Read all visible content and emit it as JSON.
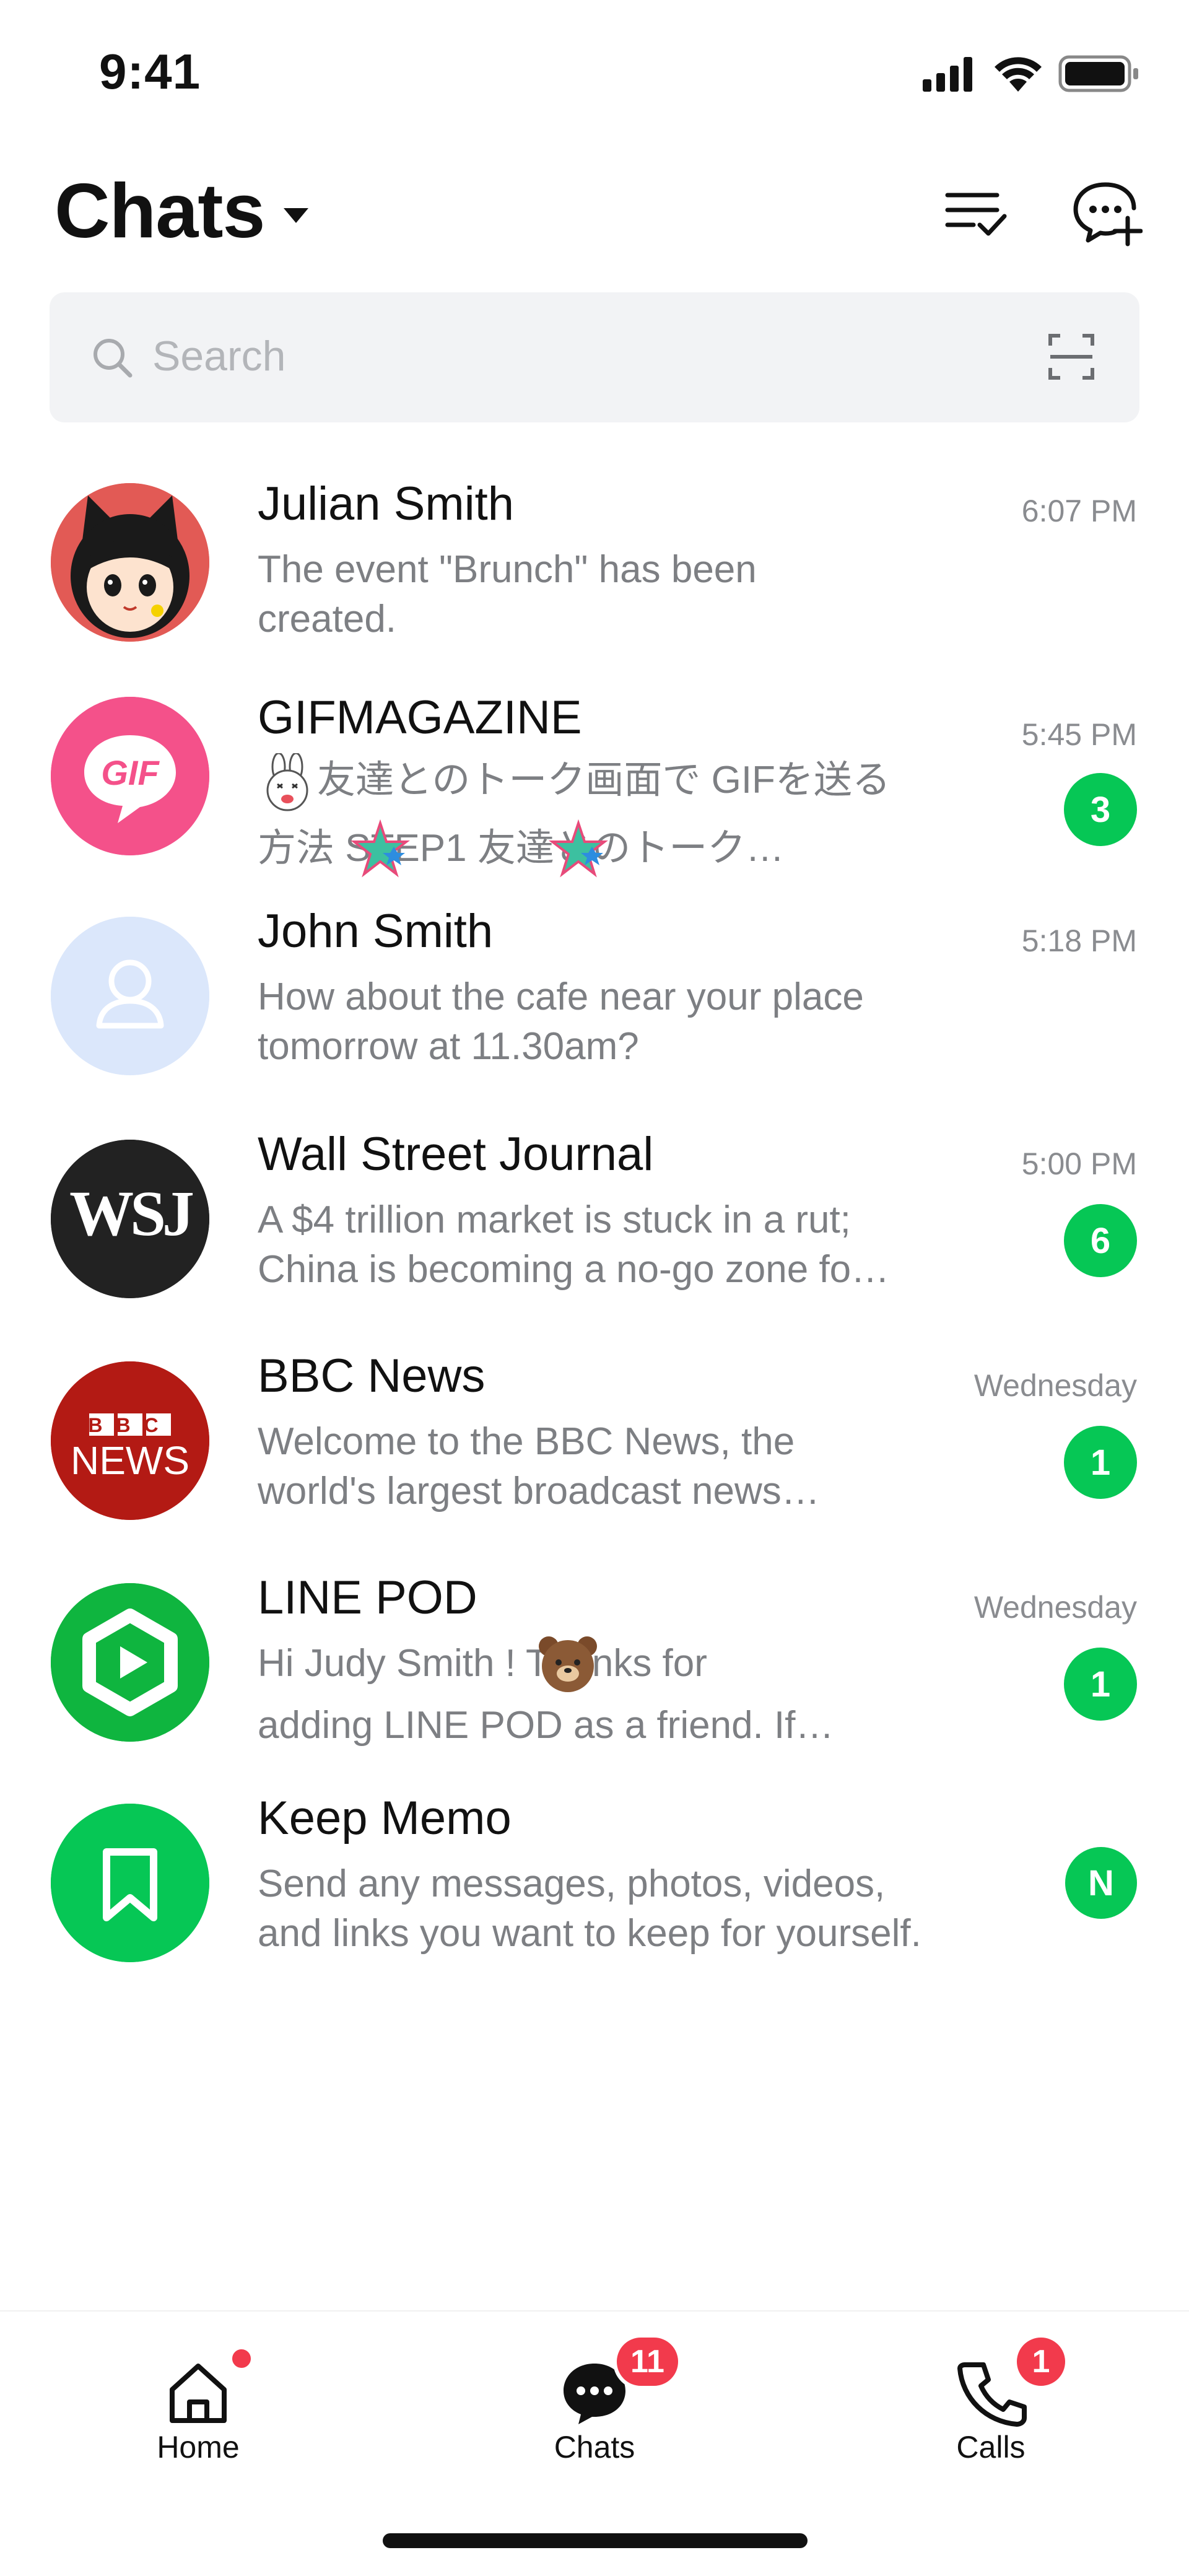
{
  "status_bar": {
    "time": "9:41"
  },
  "header": {
    "title": "Chats"
  },
  "search": {
    "placeholder": "Search"
  },
  "chats": [
    {
      "name": "Julian Smith",
      "preview_lines": [
        "The event \"Brunch\" has been",
        "created."
      ],
      "time": "6:07 PM",
      "badge": "",
      "avatar": "cat-girl-avatar"
    },
    {
      "name": "GIFMAGAZINE",
      "preview_lines": [
        "友達とのトーク画面で GIFを送る",
        "方法 STEP1 友達とのトーク…"
      ],
      "time": "5:45 PM",
      "badge": "3",
      "avatar": "gif-logo",
      "avatar_text": "GIF"
    },
    {
      "name": "John Smith",
      "preview_lines": [
        "How about the cafe near your place",
        "tomorrow at 11.30am?"
      ],
      "time": "5:18 PM",
      "badge": "",
      "avatar": "default-person-avatar"
    },
    {
      "name": "Wall Street Journal",
      "preview_lines": [
        "A $4 trillion market is stuck in a rut;",
        "China is becoming a no-go zone fo…"
      ],
      "time": "5:00 PM",
      "badge": "6",
      "avatar": "wsj-logo",
      "avatar_text": "WSJ"
    },
    {
      "name": "BBC News",
      "preview_lines": [
        "Welcome to the BBC News, the",
        "world's largest broadcast news…"
      ],
      "time": "Wednesday",
      "badge": "1",
      "avatar": "bbc-news-logo",
      "avatar_text_top": "BBC",
      "avatar_text_bottom": "NEWS"
    },
    {
      "name": "LINE POD",
      "preview_lines": [
        "Hi Judy Smith ! Thanks for",
        "adding LINE POD as a friend. If…"
      ],
      "time": "Wednesday",
      "badge": "1",
      "avatar": "line-pod-logo"
    },
    {
      "name": "Keep Memo",
      "preview_lines": [
        "Send any messages, photos, videos,",
        "and links you want to keep for yourself."
      ],
      "time": "",
      "badge": "N",
      "avatar": "bookmark-avatar"
    }
  ],
  "tabbar": {
    "home": {
      "label": "Home"
    },
    "chats": {
      "label": "Chats",
      "badge": "11"
    },
    "calls": {
      "label": "Calls",
      "badge": "1"
    }
  },
  "colors": {
    "accent_green": "#06c755",
    "badge_red": "#f23a4c",
    "text_secondary": "#7d7f83"
  }
}
